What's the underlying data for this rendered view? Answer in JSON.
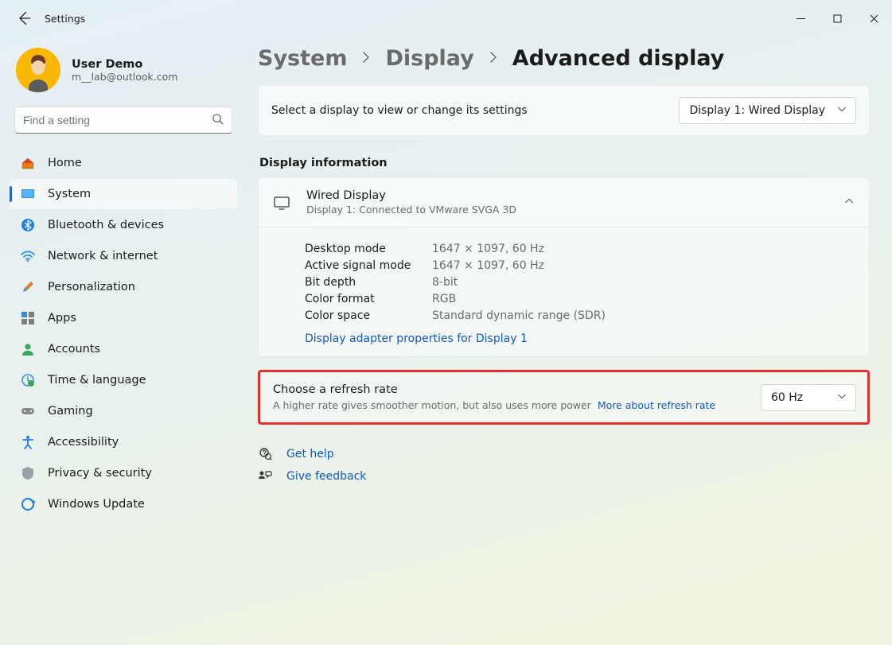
{
  "window": {
    "title": "Settings"
  },
  "user": {
    "name": "User Demo",
    "email": "m__lab@outlook.com"
  },
  "search": {
    "placeholder": "Find a setting"
  },
  "sidebar": {
    "items": [
      {
        "label": "Home"
      },
      {
        "label": "System"
      },
      {
        "label": "Bluetooth & devices"
      },
      {
        "label": "Network & internet"
      },
      {
        "label": "Personalization"
      },
      {
        "label": "Apps"
      },
      {
        "label": "Accounts"
      },
      {
        "label": "Time & language"
      },
      {
        "label": "Gaming"
      },
      {
        "label": "Accessibility"
      },
      {
        "label": "Privacy & security"
      },
      {
        "label": "Windows Update"
      }
    ]
  },
  "breadcrumb": {
    "a": "System",
    "b": "Display",
    "c": "Advanced display"
  },
  "selectDisplay": {
    "prompt": "Select a display to view or change its settings",
    "selected": "Display 1: Wired Display"
  },
  "displayInfo": {
    "sectionTitle": "Display information",
    "title": "Wired Display",
    "sub": "Display 1: Connected to VMware SVGA 3D",
    "rows": {
      "desktopModeKey": "Desktop mode",
      "desktopModeVal": "1647 × 1097, 60 Hz",
      "activeSignalKey": "Active signal mode",
      "activeSignalVal": "1647 × 1097, 60 Hz",
      "bitDepthKey": "Bit depth",
      "bitDepthVal": "8-bit",
      "colorFormatKey": "Color format",
      "colorFormatVal": "RGB",
      "colorSpaceKey": "Color space",
      "colorSpaceVal": "Standard dynamic range (SDR)"
    },
    "adapterLink": "Display adapter properties for Display 1"
  },
  "refresh": {
    "title": "Choose a refresh rate",
    "sub": "A higher rate gives smoother motion, but also uses more power",
    "moreLink": "More about refresh rate",
    "selected": "60 Hz"
  },
  "footerLinks": {
    "help": "Get help",
    "feedback": "Give feedback"
  }
}
